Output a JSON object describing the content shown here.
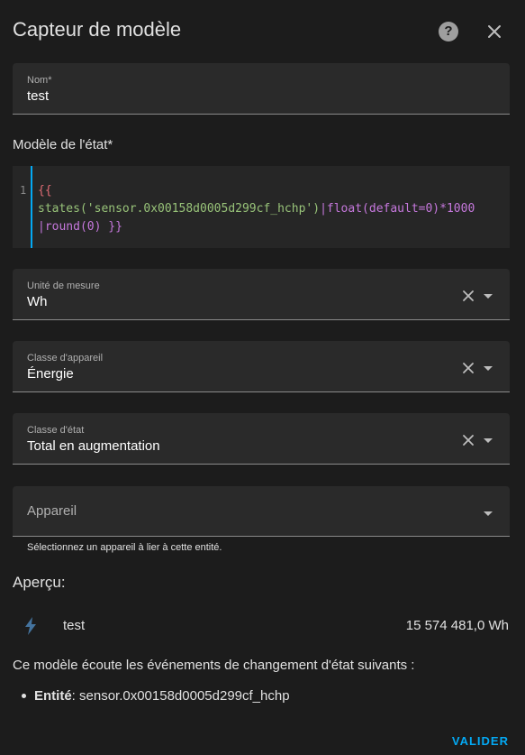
{
  "dialog": {
    "title": "Capteur de modèle",
    "help_icon": "help-circle-icon",
    "close_icon": "close-icon"
  },
  "name_field": {
    "label": "Nom*",
    "value": "test"
  },
  "template_section": {
    "label": "Modèle de l'état*",
    "line_number": "1",
    "code_line1": "{{",
    "code_line2_str": "states('sensor.0x00158d0005d299cf_hchp')",
    "code_line2_filter": "|float(default=0)*1000",
    "code_line3": "|round(0) }}"
  },
  "unit_field": {
    "label": "Unité de mesure",
    "value": "Wh"
  },
  "device_class_field": {
    "label": "Classe d'appareil",
    "value": "Énergie"
  },
  "state_class_field": {
    "label": "Classe d'état",
    "value": "Total en augmentation"
  },
  "device_field": {
    "placeholder": "Appareil",
    "helper": "Sélectionnez un appareil à lier à cette entité."
  },
  "preview": {
    "heading": "Aperçu:",
    "icon": "lightning-bolt-icon",
    "entity_name": "test",
    "entity_value": "15 574 481,0 Wh"
  },
  "listeners": {
    "intro": "Ce modèle écoute les événements de changement d'état suivants :",
    "item_label": "Entité",
    "item_value": ": sensor.0x00158d0005d299cf_hchp"
  },
  "actions": {
    "submit_label": "VALIDER"
  },
  "colors": {
    "background": "#1c1c1c",
    "field_background": "#2a2a2a",
    "accent": "#03a9f4",
    "icon_bolt": "#44739e"
  }
}
